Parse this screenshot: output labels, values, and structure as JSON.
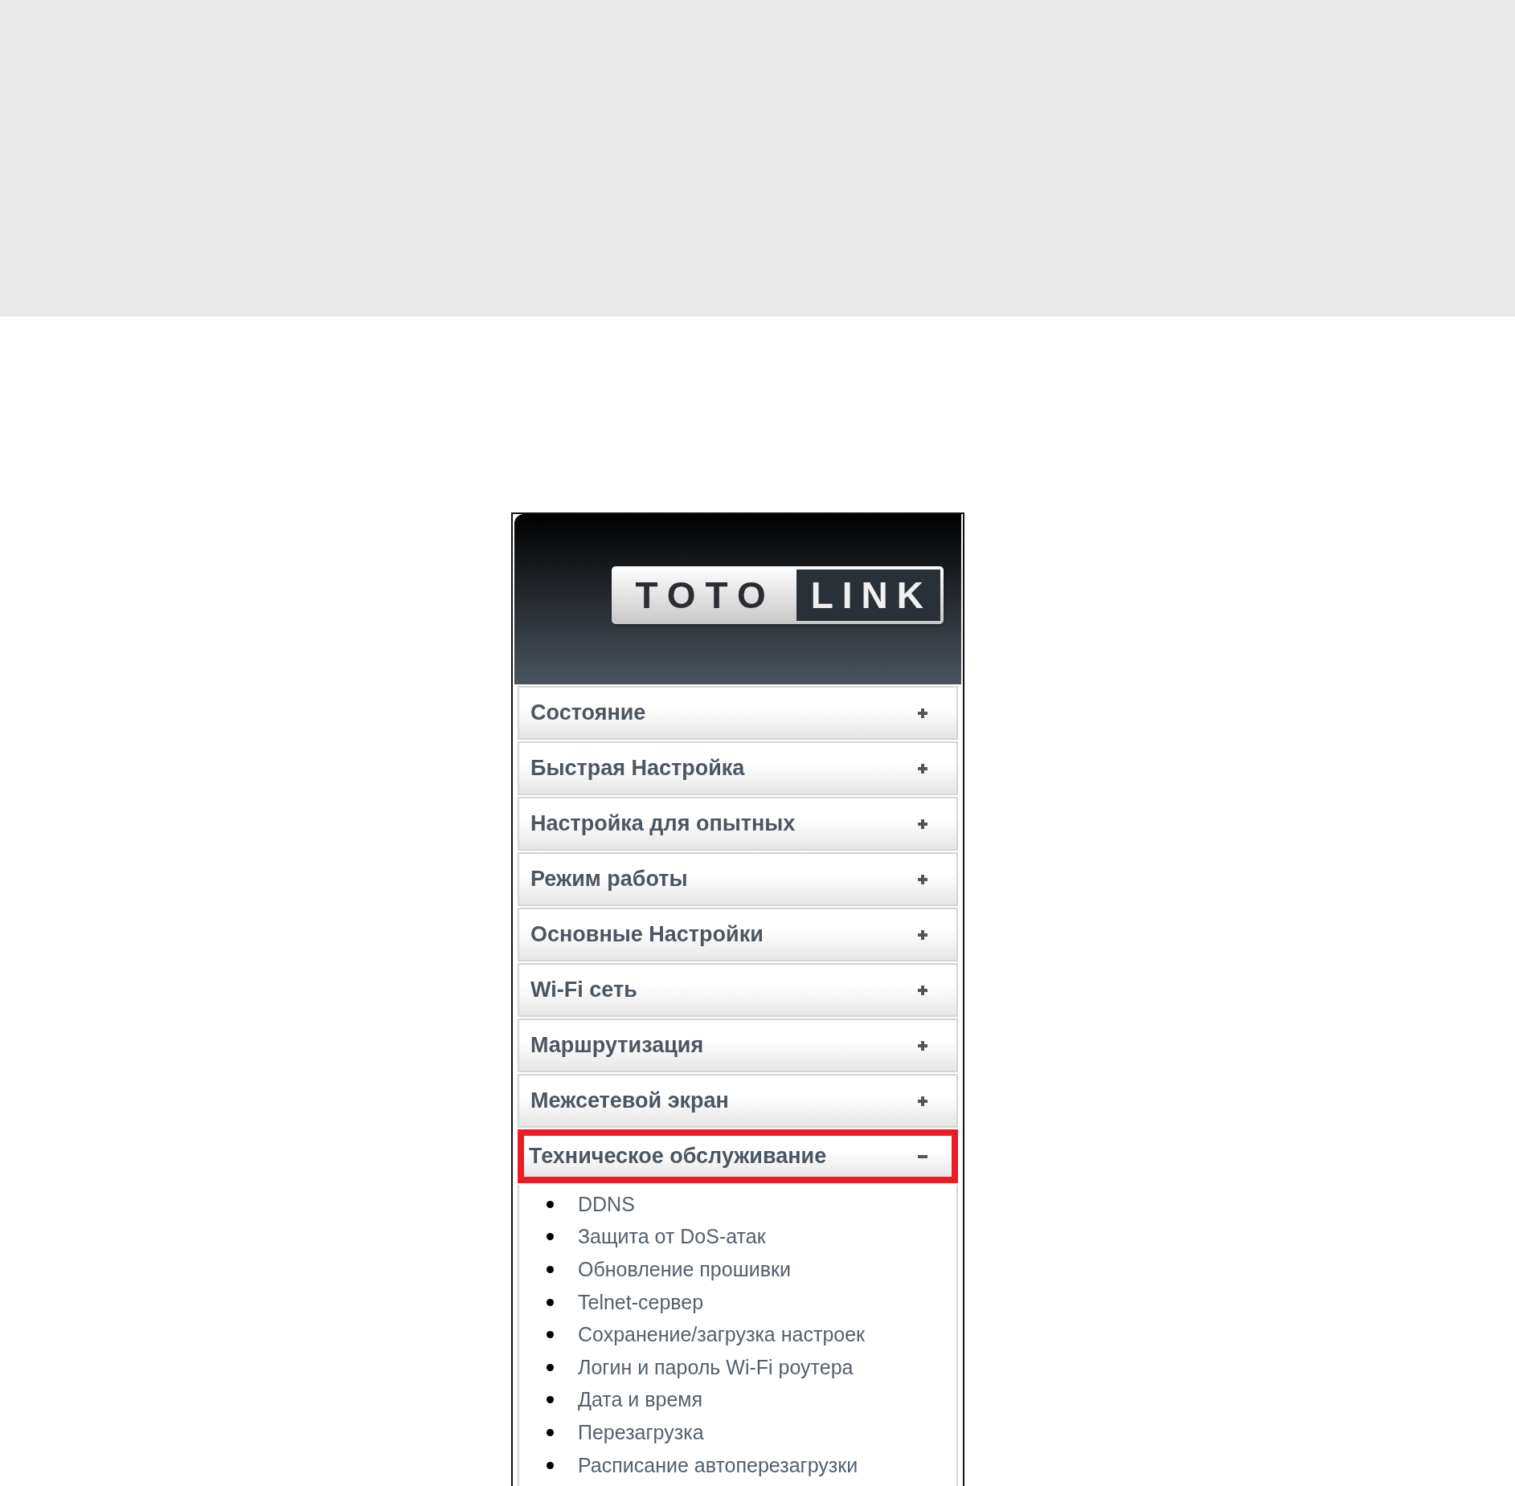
{
  "logo": {
    "left": "TOTO",
    "right": "LINK"
  },
  "menu": [
    {
      "label": "Состояние",
      "expanded": false,
      "highlighted": false
    },
    {
      "label": "Быстрая Настройка",
      "expanded": false,
      "highlighted": false
    },
    {
      "label": "Настройка для опытных",
      "expanded": false,
      "highlighted": false
    },
    {
      "label": "Режим работы",
      "expanded": false,
      "highlighted": false
    },
    {
      "label": "Основные Настройки",
      "expanded": false,
      "highlighted": false
    },
    {
      "label": "Wi-Fi сеть",
      "expanded": false,
      "highlighted": false
    },
    {
      "label": "Маршрутизация",
      "expanded": false,
      "highlighted": false
    },
    {
      "label": "Межсетевой экран",
      "expanded": false,
      "highlighted": false
    },
    {
      "label": "Техническое обслуживание",
      "expanded": true,
      "highlighted": true,
      "children": [
        "DDNS",
        "Защита от DoS-атак",
        "Обновление прошивки",
        "Telnet-сервер",
        "Сохранение/загрузка настроек",
        "Логин и пароль Wi-Fi роутера",
        "Дата и время",
        "Перезагрузка",
        "Расписание автоперезагрузки"
      ]
    }
  ]
}
